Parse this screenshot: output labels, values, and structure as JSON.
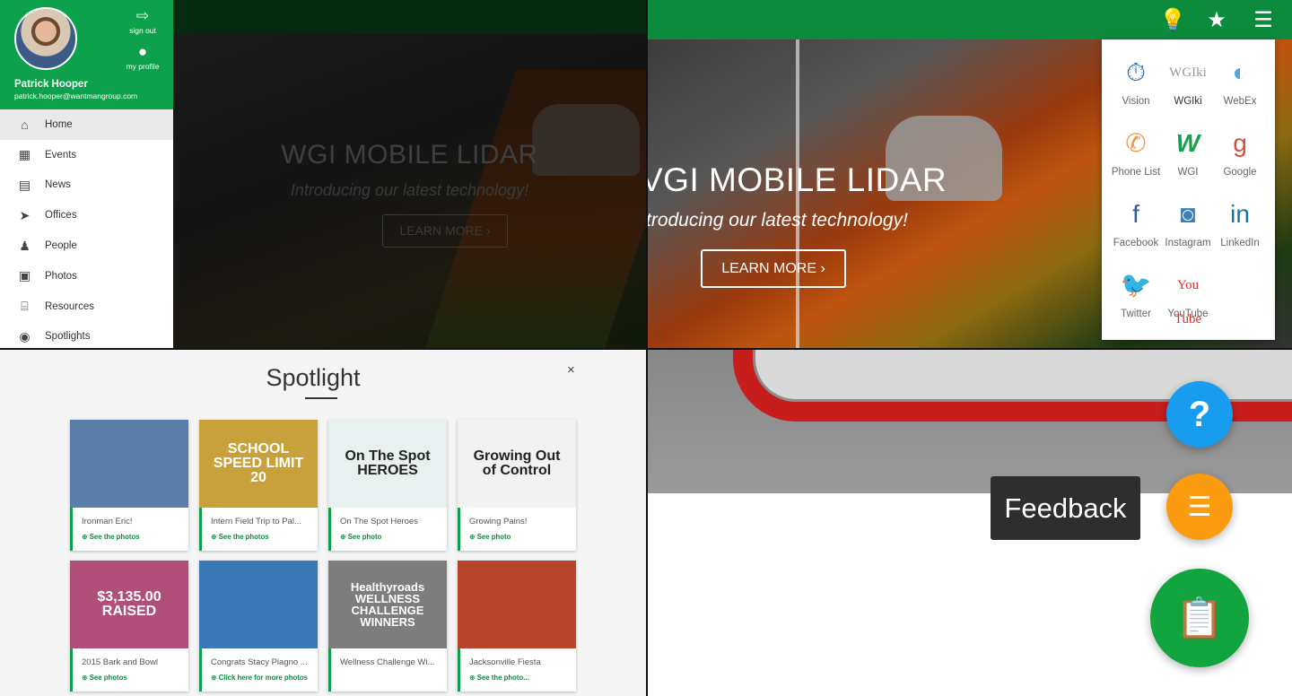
{
  "sidebar": {
    "user_name": "Patrick Hooper",
    "user_email": "patrick.hooper@wantmangroup.com",
    "sign_out": "sign out",
    "my_profile": "my profile",
    "items": [
      {
        "label": "Home",
        "icon": "home-icon",
        "glyph": "⌂",
        "active": true
      },
      {
        "label": "Events",
        "icon": "calendar-icon",
        "glyph": "▦"
      },
      {
        "label": "News",
        "icon": "newspaper-icon",
        "glyph": "▤"
      },
      {
        "label": "Offices",
        "icon": "location-arrow-icon",
        "glyph": "➤"
      },
      {
        "label": "People",
        "icon": "people-icon",
        "glyph": "♟"
      },
      {
        "label": "Photos",
        "icon": "image-icon",
        "glyph": "▣"
      },
      {
        "label": "Resources",
        "icon": "bank-icon",
        "glyph": "⌸"
      },
      {
        "label": "Spotlights",
        "icon": "lightbulb-icon",
        "glyph": "◉"
      }
    ]
  },
  "hero": {
    "title": "WGI MOBILE LIDAR",
    "subtitle": "Introducing our latest technology!",
    "button": "LEARN MORE  ›",
    "title_cropped": "VGI MOBILE LIDAR",
    "subtitle_cropped": "troducing our latest technology!"
  },
  "apps_menu": {
    "items": [
      {
        "label": "Vision",
        "icon": "stopwatch-icon",
        "glyph": "⏱",
        "color": "#1f6fb5"
      },
      {
        "label": "WGIki",
        "icon": "wgiki-logo-icon",
        "glyph": "WGIki",
        "color": "#9a9a9a"
      },
      {
        "label": "WebEx",
        "icon": "webex-icon",
        "glyph": "◐",
        "color": "#58a5e0"
      },
      {
        "label": "Phone List",
        "icon": "phone-icon",
        "glyph": "✆",
        "color": "#f39a4a"
      },
      {
        "label": "WGI",
        "icon": "wgi-logo-icon",
        "glyph": "W",
        "color": "#1b9e4b"
      },
      {
        "label": "Google",
        "icon": "google-icon",
        "glyph": "g",
        "color": "#dd4b39"
      },
      {
        "label": "Facebook",
        "icon": "facebook-icon",
        "glyph": "f",
        "color": "#3b5998"
      },
      {
        "label": "Instagram",
        "icon": "instagram-icon",
        "glyph": "◙",
        "color": "#3f7fb8"
      },
      {
        "label": "LinkedIn",
        "icon": "linkedin-icon",
        "glyph": "in",
        "color": "#0e76a8"
      },
      {
        "label": "Twitter",
        "icon": "twitter-icon",
        "glyph": "🐦",
        "color": "#2aa3ef"
      },
      {
        "label": "YouTube",
        "icon": "youtube-icon",
        "glyph": "You Tube",
        "color": "#e52d27"
      }
    ]
  },
  "spotlight": {
    "title": "Spotlight",
    "close": "×",
    "cards": [
      {
        "title": "Ironman Eric!",
        "link": "⊕ See the photos",
        "thumb_text": "",
        "thumb_bg": "#5a7fa8"
      },
      {
        "title": "Intern Field Trip to Pal...",
        "link": "⊕ See the photos",
        "thumb_text": "SCHOOL SPEED LIMIT 20",
        "thumb_bg": "#c9a13a"
      },
      {
        "title": "On The Spot Heroes",
        "link": "⊕ See photo",
        "thumb_text": "On The Spot HEROES",
        "thumb_bg": "#e8f0f0"
      },
      {
        "title": "Growing Pains!",
        "link": "⊕ See photo",
        "thumb_text": "Growing Out of Control",
        "thumb_bg": "#f2f2f2"
      },
      {
        "title": "2015 Bark and Bowl",
        "link": "⊕ See photos",
        "thumb_text": "$3,135.00 RAISED",
        "thumb_bg": "#b0507a"
      },
      {
        "title": "Congrats Stacy Piagno ...",
        "link": "⊕ Click here for more photos",
        "thumb_text": "",
        "thumb_bg": "#3a78b8"
      },
      {
        "title": "Wellness Challenge Wi...",
        "link": "",
        "thumb_text": "Healthyroads WELLNESS CHALLENGE WINNERS",
        "thumb_bg": "#7d7d7d"
      },
      {
        "title": "Jacksonville Fiesta",
        "link": "⊕ See the photo...",
        "thumb_text": "",
        "thumb_bg": "#b8442c"
      }
    ]
  },
  "fab": {
    "help_glyph": "?",
    "feedback_glyph": "☰",
    "main_glyph": "📋",
    "tooltip": "Feedback"
  },
  "toolbar": {
    "lightbulb_glyph": "💡",
    "star_glyph": "★",
    "menu_glyph": "☰"
  }
}
